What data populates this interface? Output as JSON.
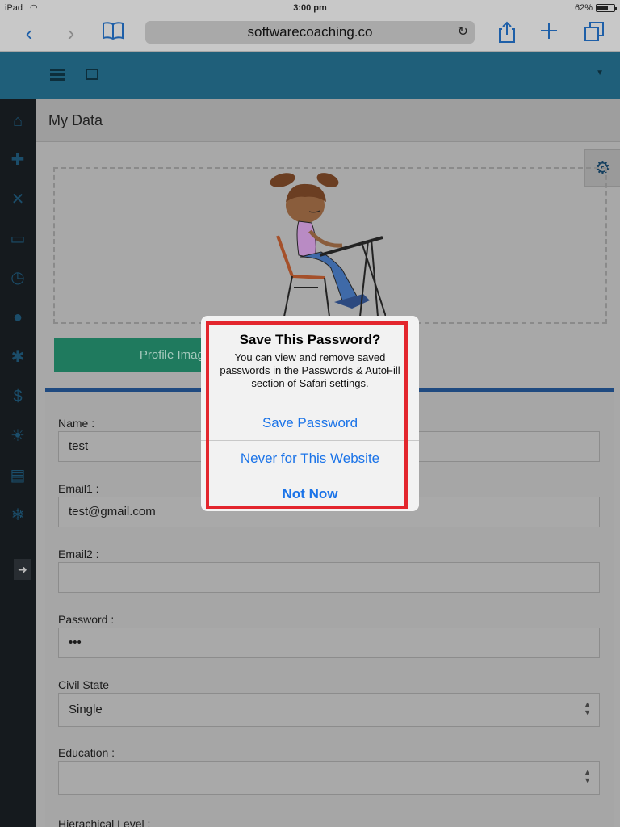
{
  "statusbar": {
    "device": "iPad",
    "time": "3:00 pm",
    "battery": "62%"
  },
  "safari": {
    "url": "softwarecoaching.co"
  },
  "page": {
    "title": "My Data",
    "profile_image_label": "Profile Image"
  },
  "form": {
    "fields": [
      {
        "label": "Name :",
        "value": "test"
      },
      {
        "label": "Email1 :",
        "value": "test@gmail.com"
      },
      {
        "label": "Email2 :",
        "value": ""
      },
      {
        "label": "Password :",
        "value": "•••"
      },
      {
        "label": "Civil State",
        "value": "Single"
      },
      {
        "label": "Education :",
        "value": ""
      },
      {
        "label": "Hierachical Level :",
        "value": ""
      }
    ]
  },
  "dialog": {
    "title": "Save This Password?",
    "message": "You can view and remove saved passwords in the Passwords & AutoFill section of Safari settings.",
    "options": [
      "Save Password",
      "Never for This Website",
      "Not Now"
    ]
  },
  "colors": {
    "accent": "#1a73e8",
    "highlight": "#e3262d",
    "header": "#1f5f7a",
    "sidebar": "#151a1e"
  },
  "icons": [
    "home-icon",
    "add-user-icon",
    "tools-icon",
    "book-icon",
    "alarm-icon",
    "user-icon",
    "settings-icon",
    "dollar-icon",
    "sun-icon",
    "clipboard-icon",
    "snowflake-icon",
    "logout-icon",
    "gear-icon"
  ]
}
